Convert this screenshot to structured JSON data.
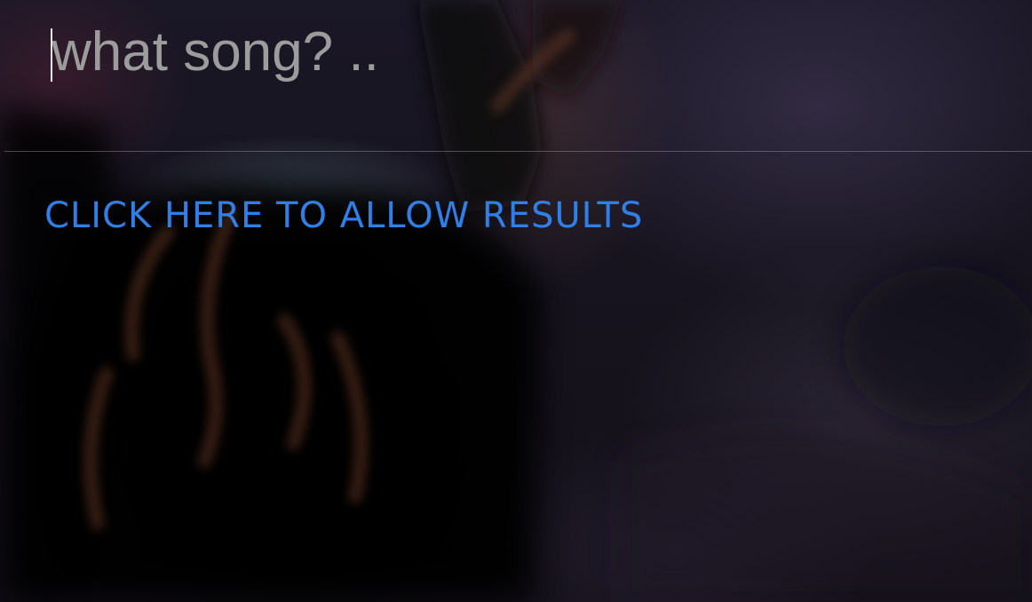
{
  "search": {
    "placeholder": "what song? ..",
    "value": ""
  },
  "results": {
    "allow_label": "CLICK HERE TO ALLOW RESULTS"
  },
  "colors": {
    "link": "#2f7fe6",
    "placeholder": "#9c9c9c",
    "divider": "#8c8c96"
  }
}
